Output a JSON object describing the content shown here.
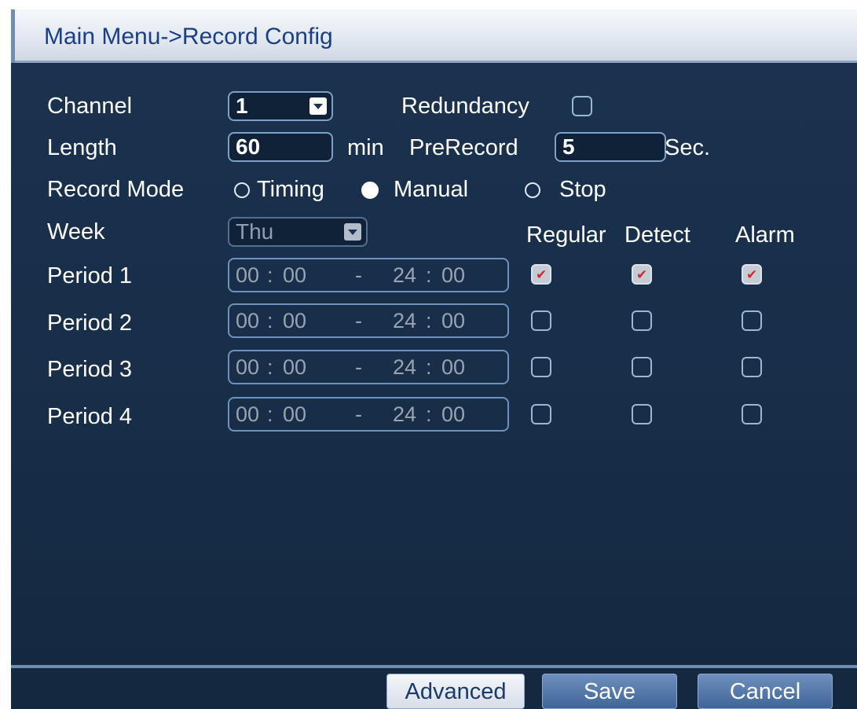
{
  "title": "Main Menu->Record Config",
  "channel": {
    "label": "Channel",
    "value": "1"
  },
  "redundancy": {
    "label": "Redundancy",
    "checked": false
  },
  "length": {
    "label": "Length",
    "value": "60",
    "unit": "min"
  },
  "prerecord": {
    "label": "PreRecord",
    "value": "5",
    "unit": "Sec."
  },
  "record_mode": {
    "label": "Record Mode",
    "options": [
      {
        "label": "Timing",
        "selected": false
      },
      {
        "label": "Manual",
        "selected": true
      },
      {
        "label": "Stop",
        "selected": false
      }
    ]
  },
  "week": {
    "label": "Week",
    "value": "Thu"
  },
  "columns": [
    "Regular",
    "Detect",
    "Alarm"
  ],
  "periods": [
    {
      "label": "Period 1",
      "start_h": "00",
      "start_m": "00",
      "end_h": "24",
      "end_m": "00",
      "regular": true,
      "detect": true,
      "alarm": true
    },
    {
      "label": "Period 2",
      "start_h": "00",
      "start_m": "00",
      "end_h": "24",
      "end_m": "00",
      "regular": false,
      "detect": false,
      "alarm": false
    },
    {
      "label": "Period 3",
      "start_h": "00",
      "start_m": "00",
      "end_h": "24",
      "end_m": "00",
      "regular": false,
      "detect": false,
      "alarm": false
    },
    {
      "label": "Period 4",
      "start_h": "00",
      "start_m": "00",
      "end_h": "24",
      "end_m": "00",
      "regular": false,
      "detect": false,
      "alarm": false
    }
  ],
  "time_sep": ":",
  "range_sep": "-",
  "buttons": {
    "advanced": "Advanced",
    "save": "Save",
    "cancel": "Cancel"
  },
  "colors": {
    "background": "#172d48",
    "title_text": "#1a3f8a",
    "check_mark": "#d22a2a",
    "border": "#7fa0c6"
  }
}
